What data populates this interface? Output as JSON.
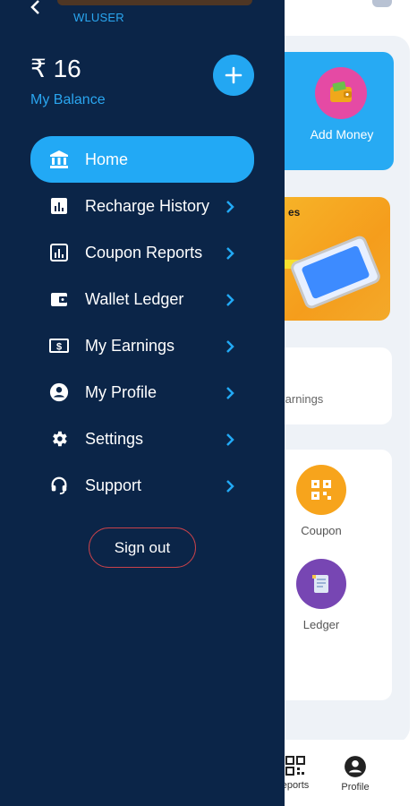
{
  "header": {
    "username": "WLUSER"
  },
  "balance": {
    "amount": "₹ 16",
    "label": "My Balance"
  },
  "menu": {
    "items": [
      {
        "label": "Home",
        "icon": "bank-icon",
        "active": true
      },
      {
        "label": "Recharge History",
        "icon": "chart-icon"
      },
      {
        "label": "Coupon Reports",
        "icon": "report-icon"
      },
      {
        "label": "Wallet Ledger",
        "icon": "wallet-icon"
      },
      {
        "label": "My Earnings",
        "icon": "cash-icon"
      },
      {
        "label": "My Profile",
        "icon": "account-icon"
      },
      {
        "label": "Settings",
        "icon": "gear-icon"
      },
      {
        "label": "Support",
        "icon": "headset-icon"
      }
    ]
  },
  "signout_label": "Sign out",
  "background": {
    "add_money_label": "Add Money",
    "earnings_label": "Earnings",
    "services": [
      {
        "label": "Coupon",
        "color": "#f7a41c"
      },
      {
        "label": "Ledger",
        "color": "#7746b3"
      }
    ],
    "bottom_nav": [
      {
        "label": "eports"
      },
      {
        "label": "Profile"
      }
    ]
  },
  "colors": {
    "drawer_bg": "#0b2548",
    "accent": "#22a9f5",
    "signout_border": "#c8424a"
  }
}
